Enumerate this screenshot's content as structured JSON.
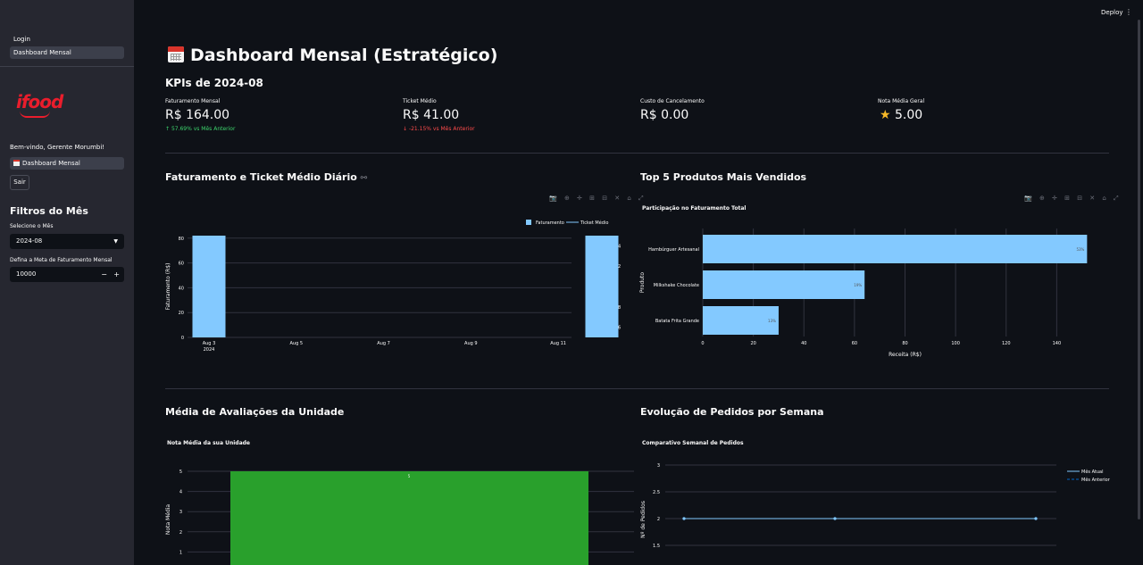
{
  "topbar": {
    "deploy_label": "Deploy",
    "menu_icon": "⋮"
  },
  "sidebar": {
    "nav": [
      {
        "label": "Login"
      },
      {
        "label": "Dashboard Mensal"
      }
    ],
    "logo_text": "ifood",
    "welcome": "Bem-vindo, Gerente Morumbi!",
    "page_button": "Dashboard Mensal",
    "logout_label": "Sair",
    "filters_heading": "Filtros do Mês",
    "month_label": "Selecione o Mês",
    "month_value": "2024-08",
    "target_label": "Defina a Meta de Faturamento Mensal",
    "target_value": "10000",
    "minus": "−",
    "plus": "+"
  },
  "main": {
    "title": "Dashboard Mensal (Estratégico)",
    "kpi_heading": "KPIs de 2024-08",
    "kpis": [
      {
        "label": "Faturamento Mensal",
        "value": "R$ 164.00",
        "delta": "57.69% vs Mês Anterior",
        "delta_dir": "up"
      },
      {
        "label": "Ticket Médio",
        "value": "R$ 41.00",
        "delta": "-21.15% vs Mês Anterior",
        "delta_dir": "down"
      },
      {
        "label": "Custo de Cancelamento",
        "value": "R$ 0.00",
        "delta": ""
      },
      {
        "label": "Nota Média Geral",
        "value": "5.00",
        "delta": ""
      }
    ],
    "sections": {
      "daily_title": "Faturamento e Ticket Médio Diário",
      "daily_link_icon": "⚯",
      "top5_title": "Top 5 Produtos Mais Vendidos",
      "ratings_title": "Média de Avaliações da Unidade",
      "weekly_title": "Evolução de Pedidos por Semana"
    },
    "toolbar_icons": "📷 ⊕ ✛ ⊞ ⊟ ✕ ⌂ ⤢"
  },
  "colors": {
    "accent_bar": "#83c9ff",
    "green_bar": "#29a02c",
    "up": "#3dd56d",
    "down": "#ff4b4b"
  },
  "chart_data": [
    {
      "type": "bar",
      "title": "",
      "legend": [
        "Faturamento",
        "Ticket Médio"
      ],
      "x_ticks": [
        "Aug 3\n2024",
        "Aug 5",
        "Aug 7",
        "Aug 9",
        "Aug 11"
      ],
      "series": [
        {
          "name": "Faturamento",
          "x": [
            "2024-08-03",
            "2024-08-12"
          ],
          "values": [
            82,
            82
          ]
        },
        {
          "name": "Ticket Médio",
          "x": [
            "2024-08-03",
            "2024-08-12"
          ],
          "values": [
            41,
            41
          ]
        }
      ],
      "ylabel": "Faturamento (R$)",
      "y2label": "Ticket Médio (R$)",
      "y_ticks": [
        "0",
        "20",
        "40",
        "60",
        "80"
      ],
      "y2_ticks": [
        "41.4",
        "41.2",
        "41",
        "40.8",
        "40.6"
      ],
      "ylim": [
        0,
        82
      ],
      "y2lim": [
        40.5,
        41.5
      ],
      "legend_position": "top-right"
    },
    {
      "type": "bar",
      "orientation": "horizontal",
      "title": "Participação no Faturamento Total",
      "categories": [
        "Hambúrguer Artesanal",
        "Milkshake Chocolate",
        "Batata Frita Grande"
      ],
      "values": [
        152,
        64,
        30
      ],
      "labels": [
        "53%",
        "19%",
        "13%"
      ],
      "xlabel": "Receita (R$)",
      "ylabel": "Produto",
      "x_ticks": [
        "0",
        "20",
        "40",
        "60",
        "80",
        "100",
        "120",
        "140"
      ],
      "xlim": [
        0,
        160
      ]
    },
    {
      "type": "bar",
      "title": "Nota Média da sua Unidade",
      "categories": [
        ""
      ],
      "values": [
        5
      ],
      "labels": [
        "5"
      ],
      "ylabel": "Nota Média",
      "y_ticks": [
        "5",
        "4",
        "3",
        "2",
        "1"
      ],
      "ylim": [
        0,
        5
      ]
    },
    {
      "type": "line",
      "title": "Comparativo Semanal de Pedidos",
      "series": [
        {
          "name": "Mês Atual",
          "values": [
            2,
            2,
            2
          ]
        },
        {
          "name": "Mês Anterior",
          "values": [
            2,
            2,
            2
          ]
        }
      ],
      "ylabel": "Nº de Pedidos",
      "y_ticks": [
        "3",
        "2.5",
        "2",
        "1.5"
      ],
      "ylim": [
        1.3,
        3.1
      ],
      "legend_position": "top-right"
    }
  ]
}
